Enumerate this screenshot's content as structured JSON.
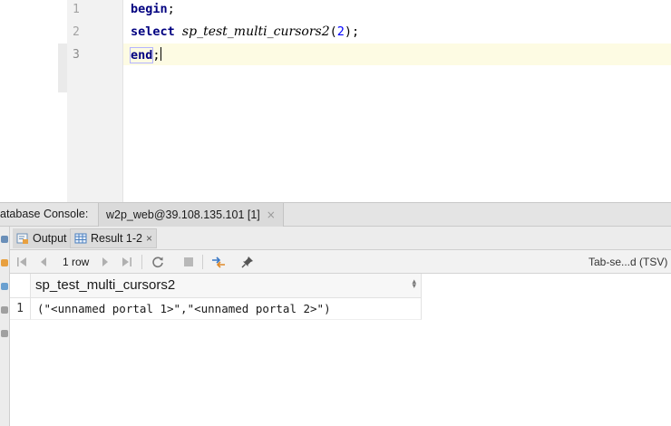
{
  "editor": {
    "line_numbers": [
      "1",
      "2",
      "3"
    ],
    "lines": {
      "l1_kw": "begin",
      "l1_rest": ";",
      "l2_kw": "select",
      "l2_func": "sp_test_multi_cursors2",
      "l2_open": "(",
      "l2_arg": "2",
      "l2_close": ");",
      "l3_kw": "end",
      "l3_rest": ";"
    }
  },
  "console": {
    "label": "atabase Console:",
    "tab_label": "w2p_web@39.108.135.101 [1]",
    "tab_close": "×"
  },
  "result_tabs": {
    "output_label": "Output",
    "result_label": "Result 1-2",
    "result_close": "×"
  },
  "toolbar": {
    "row_count": "1 row",
    "format": "Tab-se...d (TSV)"
  },
  "grid": {
    "columns": [
      "sp_test_multi_cursors2"
    ],
    "rows": [
      {
        "num": "1",
        "values": [
          "(\"<unnamed portal 1>\",\"<unnamed portal 2>\")"
        ]
      }
    ]
  },
  "colors": {
    "keyword": "#000080",
    "number": "#0000ff",
    "current_line": "#fdfbe3"
  }
}
